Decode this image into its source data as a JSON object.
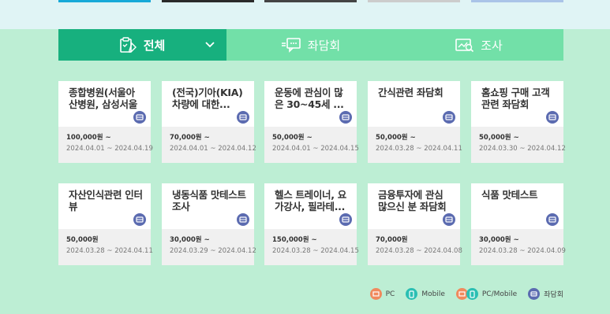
{
  "tabs": [
    {
      "label": "전체",
      "active": true,
      "icon": "list-check-icon"
    },
    {
      "label": "좌담회",
      "active": false,
      "icon": "chat-icon"
    },
    {
      "label": "조사",
      "active": false,
      "icon": "survey-icon"
    }
  ],
  "cards": [
    {
      "title": "종합병원(서울아산병원, 삼성서울병...",
      "price": "100,000원 ~",
      "date": "2024.04.01 ~ 2024.04.19",
      "type": "roundtable"
    },
    {
      "title": "(전국)기아(KIA) 차량에 대한...",
      "price": "70,000원 ~",
      "date": "2024.04.01 ~ 2024.04.12",
      "type": "roundtable"
    },
    {
      "title": "운동에 관심이 많은 30~45세 ...",
      "price": "50,000원 ~",
      "date": "2024.04.01 ~ 2024.04.15",
      "type": "roundtable"
    },
    {
      "title": "간식관련 좌담회",
      "price": "50,000원 ~",
      "date": "2024.03.28 ~ 2024.04.11",
      "type": "roundtable"
    },
    {
      "title": "홈쇼핑 구매 고객 관련 좌담회",
      "price": "50,000원 ~",
      "date": "2024.03.30 ~ 2024.04.12",
      "type": "roundtable"
    },
    {
      "title": "자산인식관련 인터뷰",
      "price": "50,000원",
      "date": "2024.03.28 ~ 2024.04.11",
      "type": "roundtable"
    },
    {
      "title": "냉동식품 맛테스트 조사",
      "price": "30,000원 ~",
      "date": "2024.03.29 ~ 2024.04.12",
      "type": "roundtable"
    },
    {
      "title": "헬스 트레이너, 요가강사, 필라테...",
      "price": "150,000원 ~",
      "date": "2024.03.28 ~ 2024.04.15",
      "type": "roundtable"
    },
    {
      "title": "금융투자에 관심 많으신 분 좌담회",
      "price": "70,000원",
      "date": "2024.03.28 ~ 2024.04.08",
      "type": "roundtable"
    },
    {
      "title": "식품 맛테스트",
      "price": "30,000원 ~",
      "date": "2024.03.28 ~ 2024.04.09",
      "type": "roundtable"
    }
  ],
  "legend": [
    {
      "label": "PC",
      "color": "#f08a5d"
    },
    {
      "label": "Mobile",
      "color": "#2bbfb3"
    },
    {
      "label": "PC/Mobile",
      "color": "#f08a5d"
    },
    {
      "label": "좌담회",
      "color": "#5b6bb0"
    }
  ],
  "colors": {
    "tab_active": "#17b07e",
    "tab_inactive": "#72e0a8",
    "background": "#bdeed4",
    "roundtable_icon": "#5b6bb0"
  }
}
